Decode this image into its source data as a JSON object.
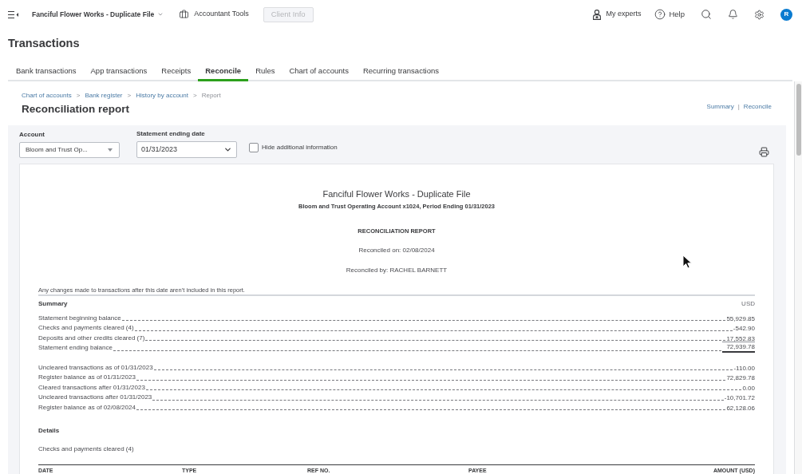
{
  "top_bar": {
    "company": "Fanciful Flower Works - Duplicate File",
    "accountant_tools": "Accountant Tools",
    "client_info": {
      "label": "Client Info",
      "disabled": true
    },
    "my_experts": "My experts",
    "help": "Help",
    "avatar": "R"
  },
  "page_title": "Transactions",
  "tabs": [
    {
      "label": "Bank transactions",
      "selected": false
    },
    {
      "label": "App transactions",
      "selected": false
    },
    {
      "label": "Receipts",
      "selected": false
    },
    {
      "label": "Reconcile",
      "selected": true
    },
    {
      "label": "Rules",
      "selected": false
    },
    {
      "label": "Chart of accounts",
      "selected": false
    },
    {
      "label": "Recurring transactions",
      "selected": false
    }
  ],
  "breadcrumb": [
    {
      "label": "Chart of accounts",
      "kind": "link"
    },
    {
      "label": ">",
      "kind": "separator"
    },
    {
      "label": "Bank register",
      "kind": "link"
    },
    {
      "label": ">",
      "kind": "separator"
    },
    {
      "label": "History by account",
      "kind": "link"
    },
    {
      "label": ">",
      "kind": "separator"
    },
    {
      "label": "Report",
      "kind": "current"
    }
  ],
  "report_title": "Reconciliation report",
  "view_links": [
    {
      "label": "Summary",
      "kind": "link"
    },
    {
      "label": "|",
      "kind": "separator"
    },
    {
      "label": "Reconcile",
      "kind": "link"
    }
  ],
  "filters": {
    "account": {
      "label": "Account",
      "value": "Bloom and Trust Op..."
    },
    "statement_date": {
      "label": "Statement ending date",
      "value": "01/31/2023"
    },
    "hide_additional": {
      "label": "Hide additional information",
      "checked": false
    }
  },
  "report": {
    "company": "Fanciful Flower Works - Duplicate File",
    "subtitle": "Bloom and Trust Operating Account x1024, Period Ending 01/31/2023",
    "heading": "RECONCILIATION REPORT",
    "reconciled_on": "Reconciled on: 02/08/2024",
    "reconciled_by": "Reconciled by: RACHEL BARNETT",
    "note": "Any changes made to transactions after this date aren’t included in this report.",
    "summary": {
      "title": "Summary",
      "currency": "USD",
      "groups": [
        [
          {
            "label": "Statement beginning balance",
            "value": "55,929.85",
            "kind": "line"
          },
          {
            "label": "Checks and payments cleared (4)",
            "value": "-542.90",
            "kind": "line"
          },
          {
            "label": "Deposits and other credits cleared (7)",
            "value": "17,552.83",
            "kind": "line"
          },
          {
            "label": "Statement ending balance",
            "value": "72,939.78",
            "kind": "total"
          }
        ],
        [
          {
            "label": "Uncleared transactions as of 01/31/2023",
            "value": "-110.00",
            "kind": "line"
          },
          {
            "label": "Register balance as of 01/31/2023",
            "value": "72,829.78",
            "kind": "line"
          },
          {
            "label": "Cleared transactions after 01/31/2023",
            "value": "0.00",
            "kind": "line"
          },
          {
            "label": "Uncleared transactions after 01/31/2023",
            "value": "-10,701.72",
            "kind": "line"
          },
          {
            "label": "Register balance as of 02/08/2024",
            "value": "62,128.06",
            "kind": "line"
          }
        ]
      ]
    },
    "details": {
      "title": "Details",
      "section": "Checks and payments cleared (4)",
      "columns": [
        "DATE",
        "TYPE",
        "REF NO.",
        "PAYEE",
        "AMOUNT (USD)"
      ]
    }
  }
}
